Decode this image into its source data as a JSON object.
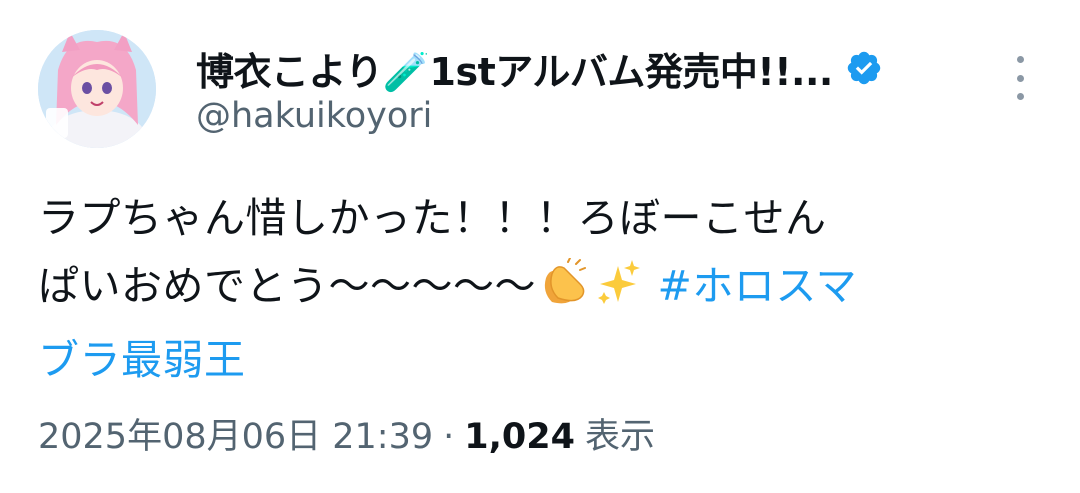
{
  "author": {
    "display_name": "博衣こより🧪1stアルバム発売中!!...",
    "handle": "@hakuikoyori",
    "verified": true
  },
  "tweet": {
    "line1": "ラプちゃん惜しかった！！！ろぼーこせん",
    "line2_text": "ぱいおめでとう〜〜〜〜〜",
    "line2_emojis": [
      "clapping-hands",
      "sparkles"
    ],
    "hashtag_part1": "#ホロスマ",
    "hashtag_part2": "ブラ最弱王"
  },
  "meta": {
    "timestamp": "2025年08月06日 21:39",
    "separator": "·",
    "views_count": "1,024",
    "views_label": "表示"
  },
  "colors": {
    "link": "#1d9bf0",
    "verified": "#1d9bf0",
    "secondary_text": "#536471",
    "primary_text": "#0f1419"
  }
}
